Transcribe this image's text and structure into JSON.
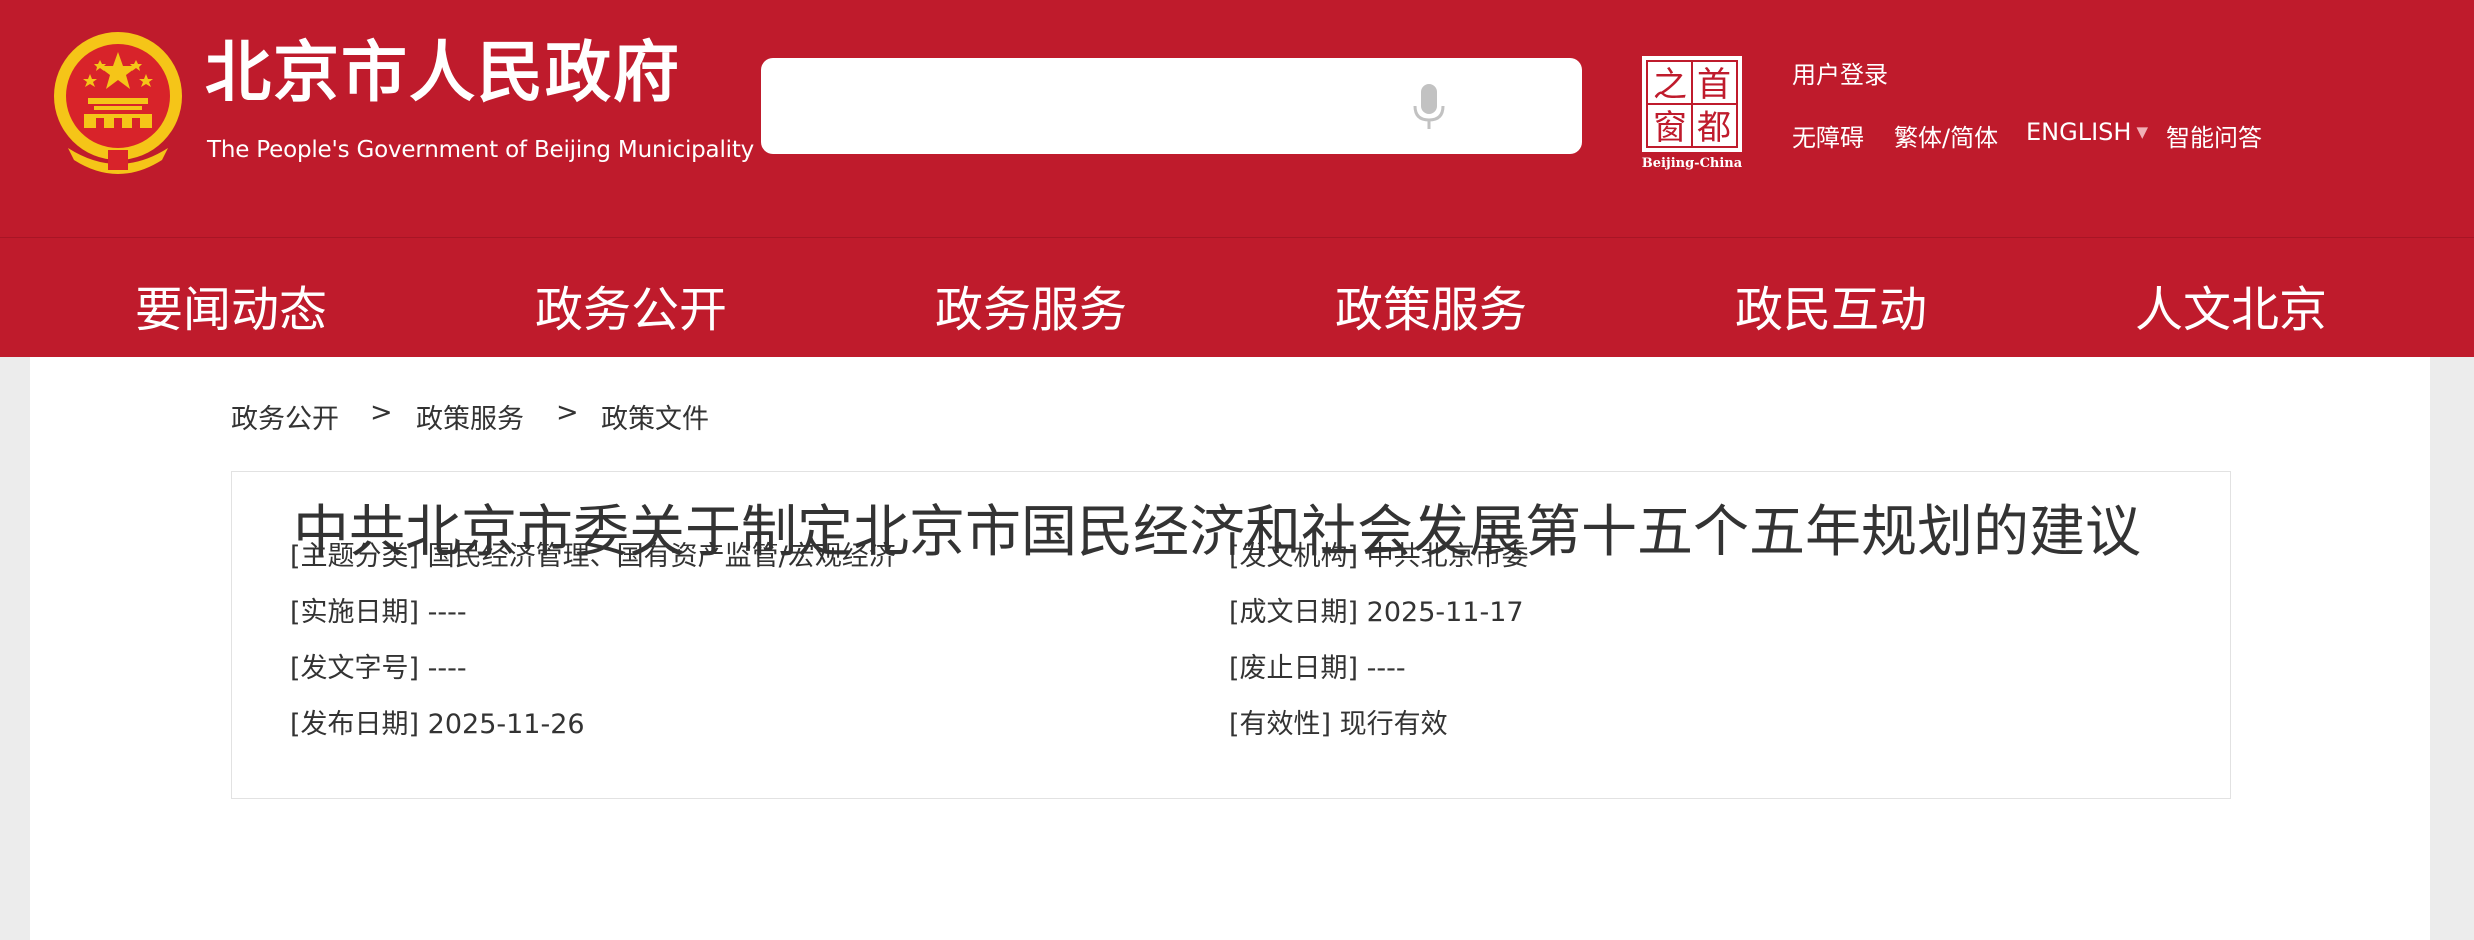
{
  "header": {
    "logo_cn": "北京市人民政府",
    "logo_en": "The People's Government of Beijing Municipality",
    "search_placeholder": "",
    "capital_logo_chars": [
      "首",
      "都",
      "之",
      "窗"
    ],
    "capital_logo_en": "Beijing-China",
    "login": "用户登录",
    "accessibility": "无障碍",
    "traditional_simplified": "繁体/简体",
    "english": "ENGLISH",
    "smart_qa": "智能问答",
    "colors": {
      "brand_red": "#bf1b2c",
      "emblem_gold": "#f5c518"
    }
  },
  "nav": {
    "items": [
      "要闻动态",
      "政务公开",
      "政务服务",
      "政策服务",
      "政民互动",
      "人文北京"
    ]
  },
  "breadcrumb": {
    "items": [
      "政务公开",
      "政策服务",
      "政策文件"
    ],
    "separator": ">"
  },
  "info": {
    "left": [
      {
        "label": "[主题分类]",
        "value": "国民经济管理、国有资产监管/宏观经济"
      },
      {
        "label": "[实施日期]",
        "value": "----"
      },
      {
        "label": "[发文字号]",
        "value": "----"
      },
      {
        "label": "[发布日期]",
        "value": "2025-11-26"
      }
    ],
    "right": [
      {
        "label": "[发文机构]",
        "value": "中共北京市委"
      },
      {
        "label": "[成文日期]",
        "value": "2025-11-17"
      },
      {
        "label": "[废止日期]",
        "value": "----"
      },
      {
        "label": "[有效性]",
        "value": "现行有效"
      }
    ]
  },
  "document": {
    "title": "中共北京市委关于制定北京市国民经济和社会发展第十五个五年规划的建议"
  }
}
